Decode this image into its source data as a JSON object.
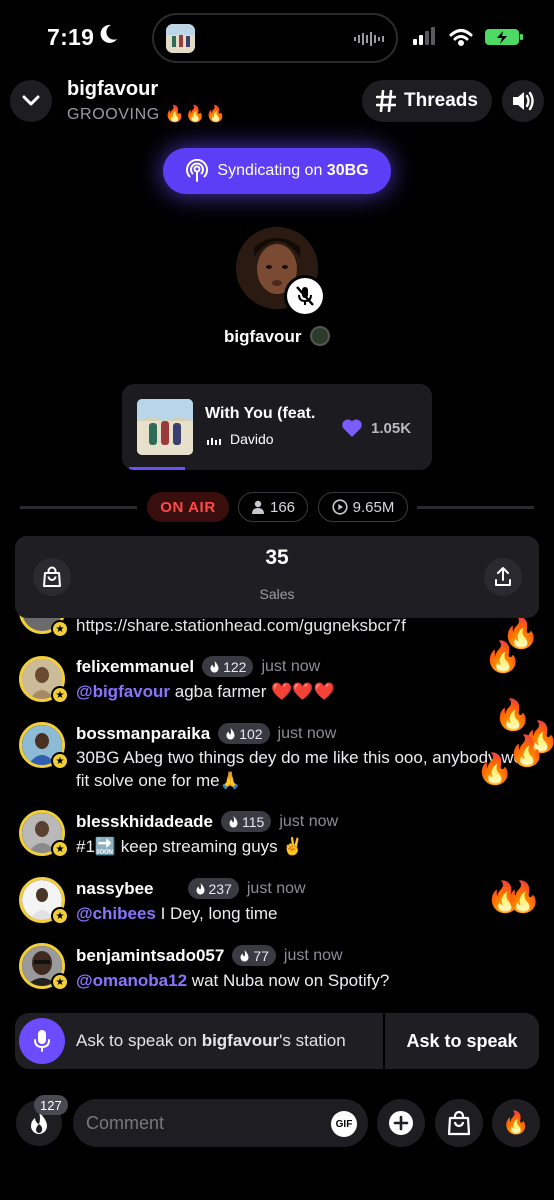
{
  "status_bar": {
    "time": "7:19"
  },
  "header": {
    "host_name": "bigfavour",
    "host_status": "GROOVING 🔥🔥🔥",
    "threads_label": "Threads"
  },
  "syndicate": {
    "prefix": "Syndicating on ",
    "station": "30BG"
  },
  "host": {
    "name": "bigfavour"
  },
  "now_playing": {
    "title": "With You (feat.",
    "artist": "Davido",
    "likes": "1.05K",
    "progress": 0.18
  },
  "stats": {
    "on_air": "ON AIR",
    "listeners": "166",
    "plays": "9.65M"
  },
  "sales": {
    "count": "35",
    "label": "Sales"
  },
  "chat": {
    "partial_message": "https://share.stationhead.com/gugneksbcr7f",
    "messages": [
      {
        "user": "felixemmanuel",
        "badge": "122",
        "time": "just now",
        "mention": "@bigfavour",
        "text": " agba farmer ❤️❤️❤️"
      },
      {
        "user": "bossmanparaika",
        "badge": "102",
        "time": "just now",
        "mention": "",
        "text": "30BG Abeg two things dey do me like this ooo, anybody wen fit solve one for me🙏"
      },
      {
        "user": "blesskhidadeade",
        "badge": "115",
        "time": "just now",
        "mention": "",
        "text": "#1🔜 keep streaming guys ✌️"
      },
      {
        "user": "nassybee",
        "badge": "237",
        "time": "just now",
        "mention": "@chibees",
        "text": " I Dey, long time"
      },
      {
        "user": "benjamintsado057",
        "badge": "77",
        "time": "just now",
        "mention": "@omanoba12",
        "text": " wat Nuba now on Spotify?"
      }
    ]
  },
  "ask_to_speak": {
    "prompt_prefix": "Ask to speak on ",
    "station_name": "bigfavour",
    "prompt_suffix": "'s station",
    "button": "Ask to speak"
  },
  "bottom_bar": {
    "fire_count": "127",
    "comment_placeholder": "Comment",
    "gif_label": "GIF"
  },
  "colors": {
    "accent": "#6b4cff",
    "on_air": "#ff4a4a",
    "avatar_ring": "#f2cf3a"
  }
}
